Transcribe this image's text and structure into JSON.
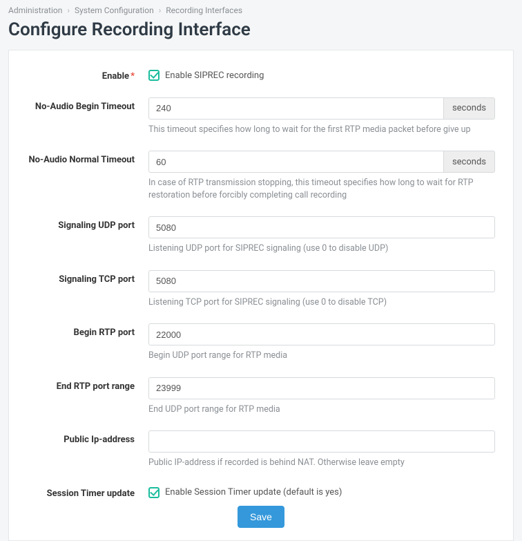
{
  "breadcrumb": {
    "items": [
      "Administration",
      "System Configuration",
      "Recording Interfaces"
    ]
  },
  "page": {
    "title": "Configure Recording Interface"
  },
  "form": {
    "enable": {
      "label": "Enable",
      "required_mark": "*",
      "checkbox_label": "Enable SIPREC recording",
      "checked": true
    },
    "no_audio_begin": {
      "label": "No-Audio Begin Timeout",
      "value": "240",
      "unit": "seconds",
      "help": "This timeout specifies how long to wait for the first RTP media packet before give up"
    },
    "no_audio_normal": {
      "label": "No-Audio Normal Timeout",
      "value": "60",
      "unit": "seconds",
      "help": "In case of RTP transmission stopping, this timeout specifies how long to wait for RTP restoration before forcibly completing call recording"
    },
    "sig_udp": {
      "label": "Signaling UDP port",
      "value": "5080",
      "help": "Listening UDP port for SIPREC signaling (use 0 to disable UDP)"
    },
    "sig_tcp": {
      "label": "Signaling TCP port",
      "value": "5080",
      "help": "Listening TCP port for SIPREC signaling (use 0 to disable TCP)"
    },
    "rtp_begin": {
      "label": "Begin RTP port",
      "value": "22000",
      "help": "Begin UDP port range for RTP media"
    },
    "rtp_end": {
      "label": "End RTP port range",
      "value": "23999",
      "help": "End UDP port range for RTP media"
    },
    "public_ip": {
      "label": "Public Ip-address",
      "value": "",
      "help": "Public IP-address if recorded is behind NAT. Otherwise leave empty"
    },
    "session_timer": {
      "label": "Session Timer update",
      "checkbox_label": "Enable Session Timer update (default is yes)",
      "checked": true
    },
    "save_button": "Save"
  }
}
